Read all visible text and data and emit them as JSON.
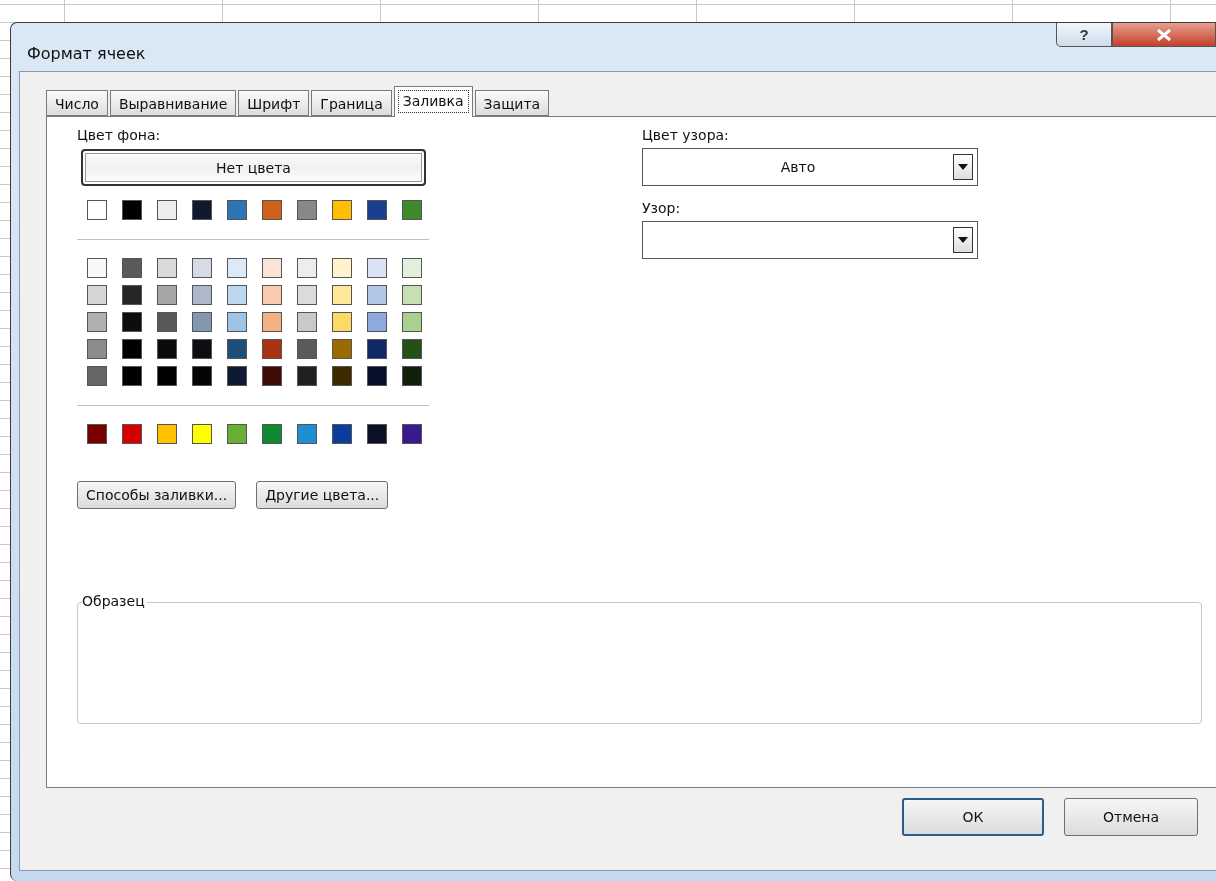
{
  "window": {
    "title": "Формат ячеек",
    "help_button": "?"
  },
  "tabs": [
    {
      "label": "Число",
      "selected": false
    },
    {
      "label": "Выравнивание",
      "selected": false
    },
    {
      "label": "Шрифт",
      "selected": false
    },
    {
      "label": "Граница",
      "selected": false
    },
    {
      "label": "Заливка",
      "selected": true
    },
    {
      "label": "Защита",
      "selected": false
    }
  ],
  "background_color": {
    "label": "Цвет фона:",
    "no_color_button": "Нет цвета",
    "theme_row": [
      {
        "color": "#ffffff"
      },
      {
        "color": "#000000"
      },
      {
        "color": "#eeeeee"
      },
      {
        "color": "#0f1a2e"
      },
      {
        "color": "#2e75b6"
      },
      {
        "color": "#d0611b"
      },
      {
        "color": "#888888"
      },
      {
        "color": "#ffbf00"
      },
      {
        "color": "#1a3f8f"
      },
      {
        "color": "#3e8a2c"
      }
    ],
    "tint_rows": [
      [
        {
          "color": "#f8f8f8"
        },
        {
          "color": "#5a5a5a"
        },
        {
          "color": "#d9d9d9"
        },
        {
          "color": "#d5dce8"
        },
        {
          "color": "#dbe9f8"
        },
        {
          "color": "#fbe4d6"
        },
        {
          "color": "#ededed"
        },
        {
          "color": "#fff2cc"
        },
        {
          "color": "#d9e1f2"
        },
        {
          "color": "#e2efda"
        }
      ],
      [
        {
          "color": "#d6d6d6"
        },
        {
          "color": "#262626"
        },
        {
          "color": "#a6a6a6"
        },
        {
          "color": "#adb9ca"
        },
        {
          "color": "#bdd7ee"
        },
        {
          "color": "#f8cbad"
        },
        {
          "color": "#dbdbdb"
        },
        {
          "color": "#ffe699"
        },
        {
          "color": "#b4c6e7"
        },
        {
          "color": "#c6e0b4"
        }
      ],
      [
        {
          "color": "#b0b0b0"
        },
        {
          "color": "#0d0d0d"
        },
        {
          "color": "#595959"
        },
        {
          "color": "#8497b0"
        },
        {
          "color": "#9dc3e6"
        },
        {
          "color": "#f4b183"
        },
        {
          "color": "#c9c9c9"
        },
        {
          "color": "#ffd966"
        },
        {
          "color": "#8ea9db"
        },
        {
          "color": "#a9d08e"
        }
      ],
      [
        {
          "color": "#8c8c8c"
        },
        {
          "color": "#000000"
        },
        {
          "color": "#0a0a0a"
        },
        {
          "color": "#0d0d12"
        },
        {
          "color": "#1f4e79"
        },
        {
          "color": "#a83212"
        },
        {
          "color": "#5a5a5a"
        },
        {
          "color": "#9a6b00"
        },
        {
          "color": "#0f2866"
        },
        {
          "color": "#245216"
        }
      ],
      [
        {
          "color": "#666666"
        },
        {
          "color": "#000000"
        },
        {
          "color": "#010101"
        },
        {
          "color": "#050508"
        },
        {
          "color": "#0e1a33"
        },
        {
          "color": "#3d0c05"
        },
        {
          "color": "#202020"
        },
        {
          "color": "#3d2a00"
        },
        {
          "color": "#06102b"
        },
        {
          "color": "#0f1f0a"
        }
      ]
    ],
    "standard_row": [
      {
        "color": "#7a0000"
      },
      {
        "color": "#d40000"
      },
      {
        "color": "#ffc000"
      },
      {
        "color": "#ffff00"
      },
      {
        "color": "#6aaf35"
      },
      {
        "color": "#108a30"
      },
      {
        "color": "#1f8fd1"
      },
      {
        "color": "#0b3d9c"
      },
      {
        "color": "#0d1126"
      },
      {
        "color": "#3a1a8f"
      }
    ],
    "fill_effects_button": "Способы заливки...",
    "more_colors_button": "Другие цвета..."
  },
  "pattern_color": {
    "label": "Цвет узора:",
    "value": "Авто"
  },
  "pattern_style": {
    "label": "Узор:"
  },
  "sample": {
    "label": "Образец"
  },
  "buttons": [
    {
      "label": "ОК",
      "default": true
    },
    {
      "label": "Отмена",
      "default": false
    }
  ]
}
